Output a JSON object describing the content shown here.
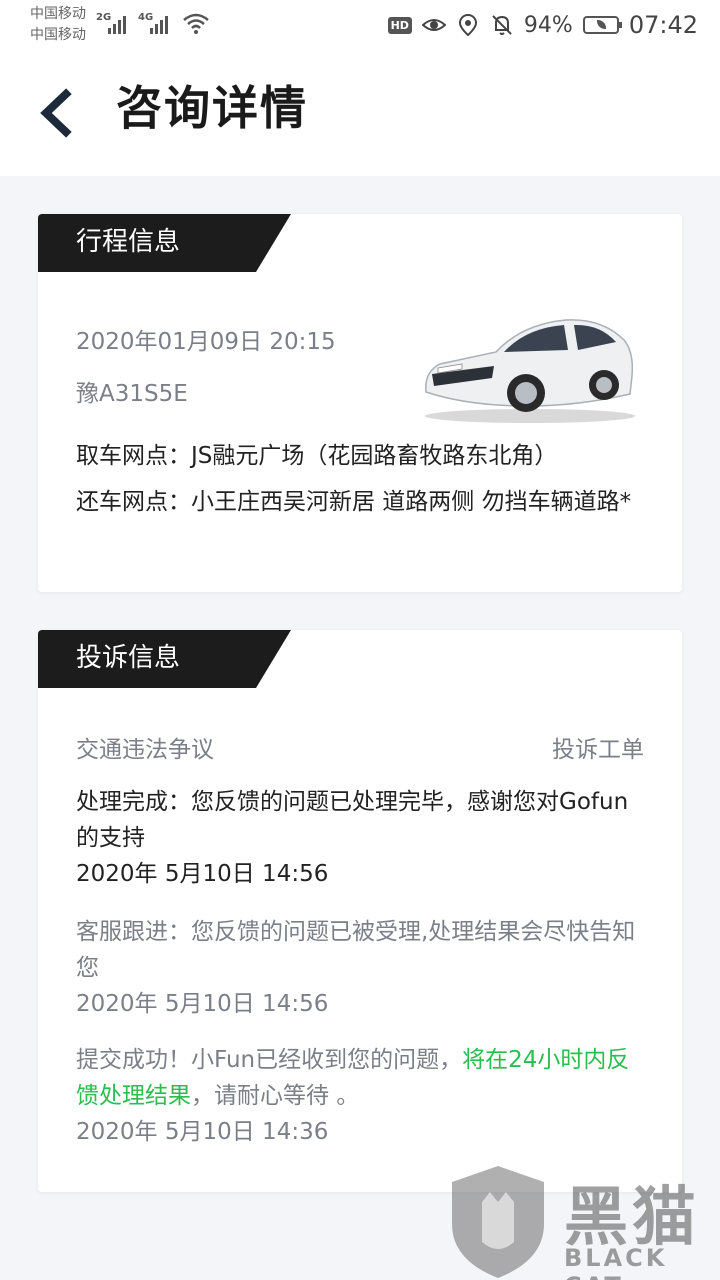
{
  "status_bar": {
    "carrier_1": "中国移动",
    "carrier_2": "中国移动",
    "network_1": "2G",
    "network_2": "4G",
    "hd": "HD",
    "battery": "94%",
    "time": "07:42"
  },
  "header": {
    "title": "咨询详情",
    "back_icon": "chevron-left-icon"
  },
  "trip": {
    "section_label": "行程信息",
    "time": "2020年01月09日 20:15",
    "plate": "豫A31S5E",
    "pickup": "取车网点：JS融元广场（花园路畜牧路东北角）",
    "return": "还车网点：小王庄西吴河新居 道路两侧 勿挡车辆道路*"
  },
  "complaint": {
    "section_label": "投诉信息",
    "category": "交通违法争议",
    "type": "投诉工单",
    "updates": [
      {
        "text": "处理完成：您反馈的问题已处理完毕，感谢您对Gofun的支持",
        "time": "2020年 5月10日 14:56"
      },
      {
        "text": "客服跟进：您反馈的问题已被受理,处理结果会尽快告知您",
        "time": "2020年 5月10日 14:56"
      },
      {
        "text_before": "提交成功！小Fun已经收到您的问题，",
        "text_highlight": "将在24小时内反馈处理结果",
        "text_after": "，请耐心等待 。",
        "time": "2020年 5月10日 14:36"
      }
    ]
  },
  "watermark": {
    "cn": "黑猫",
    "en": "BLACK CAT"
  },
  "colors": {
    "highlight": "#2bbd4f",
    "tab_bg": "#1c1c1c",
    "muted": "#7a7f88"
  }
}
